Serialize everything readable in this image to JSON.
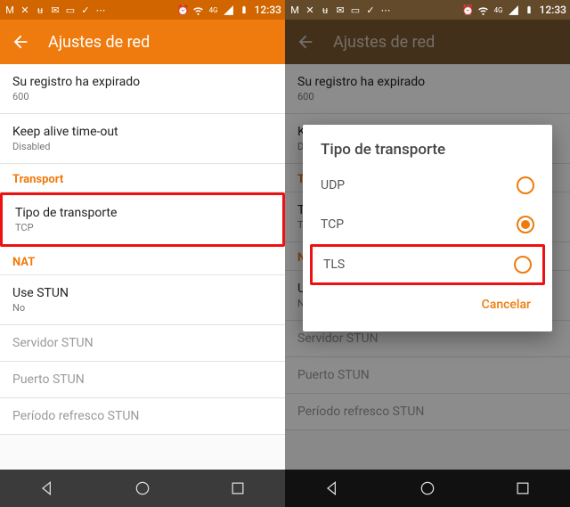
{
  "colors": {
    "accent": "#ef7b0e",
    "highlight": "#e11"
  },
  "status": {
    "time": "12:33",
    "net_label": "4G"
  },
  "header": {
    "title": "Ajustes de red"
  },
  "settings": {
    "registration": {
      "title": "Su registro ha expirado",
      "value": "600"
    },
    "keepalive": {
      "title": "Keep alive time-out",
      "value": "Disabled"
    },
    "section_transport": "Transport",
    "transport_type": {
      "title": "Tipo de transporte",
      "value": "TCP"
    },
    "section_nat": "NAT",
    "use_stun": {
      "title": "Use STUN",
      "value": "No"
    },
    "stun_server": {
      "title": "Servidor STUN"
    },
    "stun_port": {
      "title": "Puerto STUN"
    },
    "stun_refresh": {
      "title": "Período refresco STUN"
    }
  },
  "dialog": {
    "title": "Tipo de transporte",
    "options": {
      "udp": "UDP",
      "tcp": "TCP",
      "tls": "TLS"
    },
    "selected": "TCP",
    "cancel": "Cancelar"
  }
}
